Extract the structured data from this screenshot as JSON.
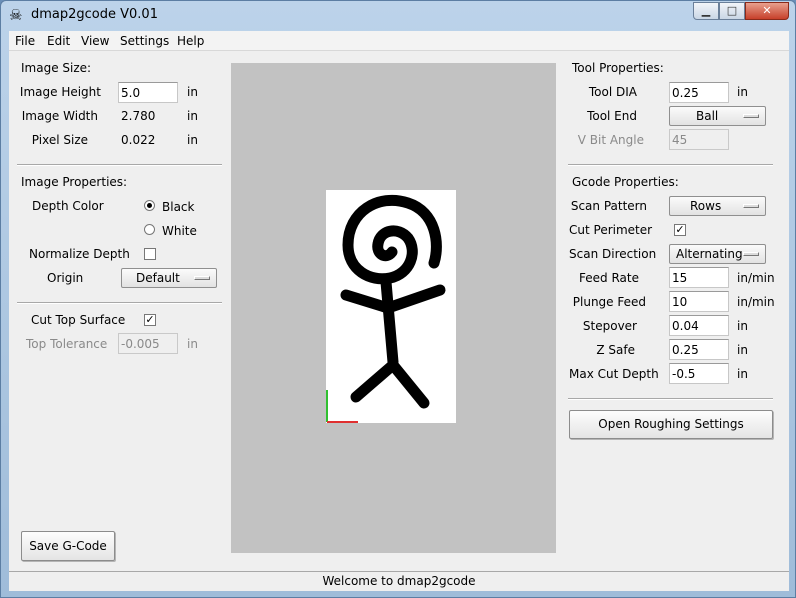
{
  "window": {
    "title": "dmap2gcode V0.01",
    "icon": "skull-icon"
  },
  "window_controls": {
    "minimize": "▁",
    "maximize": "□",
    "close": "✕"
  },
  "menu": [
    "File",
    "Edit",
    "View",
    "Settings",
    "Help"
  ],
  "image_size": {
    "heading": "Image Size:",
    "height_label": "Image Height",
    "height_value": "5.0",
    "height_unit": "in",
    "width_label": "Image Width",
    "width_value": "2.780",
    "width_unit": "in",
    "pixel_label": "Pixel Size",
    "pixel_value": "0.022",
    "pixel_unit": "in"
  },
  "image_properties": {
    "heading": "Image Properties:",
    "depth_color_label": "Depth Color",
    "depth_options": [
      {
        "label": "Black",
        "selected": true
      },
      {
        "label": "White",
        "selected": false
      }
    ],
    "normalize_label": "Normalize Depth",
    "normalize_checked": false,
    "normalize_mark": "",
    "origin_label": "Origin",
    "origin_value": "Default"
  },
  "surface": {
    "cut_top_label": "Cut Top Surface",
    "cut_top_checked": true,
    "cut_top_mark": "✓",
    "tolerance_label": "Top Tolerance",
    "tolerance_value": "-0.005",
    "tolerance_unit": "in"
  },
  "save_button": "Save G-Code",
  "tool_properties": {
    "heading": "Tool Properties:",
    "dia_label": "Tool DIA",
    "dia_value": "0.25",
    "dia_unit": "in",
    "end_label": "Tool End",
    "end_value": "Ball",
    "vbit_label": "V Bit Angle",
    "vbit_value": "45"
  },
  "gcode_properties": {
    "heading": "Gcode Properties:",
    "scan_pattern_label": "Scan Pattern",
    "scan_pattern_value": "Rows",
    "cut_perimeter_label": "Cut Perimeter",
    "cut_perimeter_checked": true,
    "cut_perimeter_mark": "✓",
    "scan_direction_label": "Scan Direction",
    "scan_direction_value": "Alternating",
    "feed_rate_label": "Feed Rate",
    "feed_rate_value": "15",
    "feed_rate_unit": "in/min",
    "plunge_label": "Plunge Feed",
    "plunge_value": "10",
    "plunge_unit": "in/min",
    "stepover_label": "Stepover",
    "stepover_value": "0.04",
    "stepover_unit": "in",
    "zsafe_label": "Z Safe",
    "zsafe_value": "0.25",
    "zsafe_unit": "in",
    "max_depth_label": "Max Cut Depth",
    "max_depth_value": "-0.5",
    "max_depth_unit": "in"
  },
  "roughing_button": "Open Roughing Settings",
  "status": "Welcome to dmap2gcode",
  "colors": {
    "preview_bg": "#c2c2c2",
    "axis_x": "#e03030",
    "axis_y": "#30c030",
    "figure": "#000000"
  }
}
